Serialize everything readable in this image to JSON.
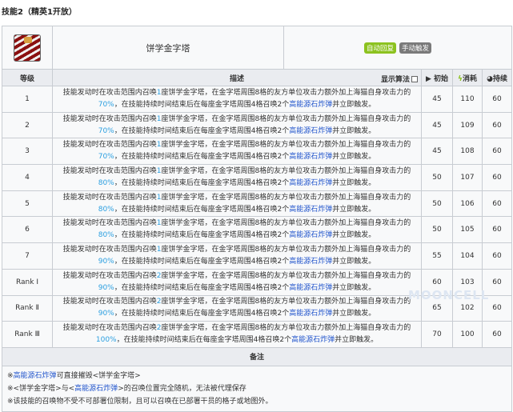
{
  "section_title": "技能2（精英1开放）",
  "skill": {
    "name": "饼学金字塔",
    "icon": "skill-icon",
    "tags": [
      {
        "label": "自动回复",
        "color": "#8cc21f"
      },
      {
        "label": "手动触发",
        "color": "#7a7a7a"
      }
    ]
  },
  "columns": {
    "level": "等级",
    "desc": "描述",
    "show_formula": "显示算法",
    "initial": "初始",
    "cost": "消耗",
    "duration": "持续"
  },
  "desc_parts": {
    "a": "技能发动时在攻击范围内召唤",
    "b": "座饼学金字塔，在金字塔周围8格的友方单位攻击力额外加上海猫自身攻击力的",
    "c": "，在技能持续时间结束后在每座金字塔周围4格召唤2个",
    "link": "高能源石炸弹",
    "d": "并立即触发。"
  },
  "rows": [
    {
      "level": "1",
      "count": "1",
      "pct": "70%",
      "initial": "45",
      "cost": "110",
      "duration": "60"
    },
    {
      "level": "2",
      "count": "1",
      "pct": "70%",
      "initial": "45",
      "cost": "109",
      "duration": "60"
    },
    {
      "level": "3",
      "count": "1",
      "pct": "70%",
      "initial": "45",
      "cost": "108",
      "duration": "60"
    },
    {
      "level": "4",
      "count": "1",
      "pct": "80%",
      "initial": "50",
      "cost": "107",
      "duration": "60"
    },
    {
      "level": "5",
      "count": "1",
      "pct": "80%",
      "initial": "50",
      "cost": "106",
      "duration": "60"
    },
    {
      "level": "6",
      "count": "1",
      "pct": "80%",
      "initial": "50",
      "cost": "105",
      "duration": "60"
    },
    {
      "level": "7",
      "count": "1",
      "pct": "90%",
      "initial": "55",
      "cost": "104",
      "duration": "60"
    },
    {
      "level": "Rank Ⅰ",
      "count": "2",
      "pct": "90%",
      "initial": "60",
      "cost": "103",
      "duration": "60"
    },
    {
      "level": "Rank Ⅱ",
      "count": "2",
      "pct": "90%",
      "initial": "65",
      "cost": "102",
      "duration": "60"
    },
    {
      "level": "Rank Ⅲ",
      "count": "2",
      "pct": "100%",
      "initial": "70",
      "cost": "100",
      "duration": "60"
    }
  ],
  "notes": {
    "title": "备注",
    "n1a": "※",
    "n1link": "高能源石炸弹",
    "n1b": "可直接摧毁<饼学金字塔>",
    "n2a": "※<饼学金字塔>与<",
    "n2link": "高能源石炸弹",
    "n2b": ">的召唤位置完全随机，无法被代理保存",
    "n3": "※该技能的召唤物不受不可部署位限制，且可以召唤在已部署干员的格子或地图外。"
  },
  "watermark": "MOONCELL"
}
